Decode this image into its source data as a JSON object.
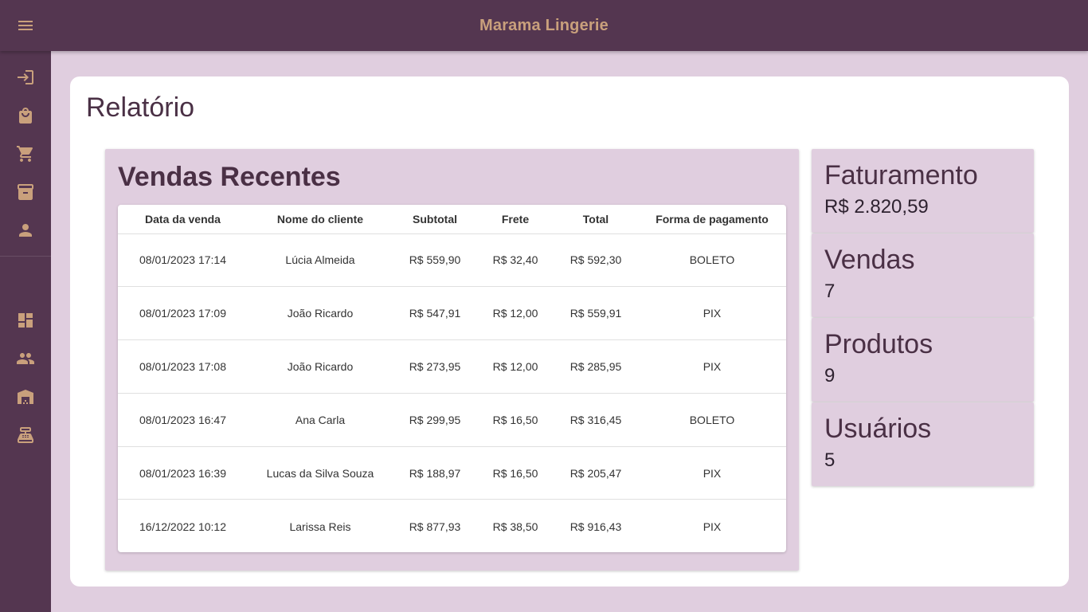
{
  "app": {
    "title": "Marama Lingerie"
  },
  "colors": {
    "primary": "#543650",
    "accent": "#c9a07c",
    "background": "#e0cedf"
  },
  "sidebar": {
    "top_items": [
      {
        "icon": "login-icon"
      },
      {
        "icon": "shopping-bag-icon"
      },
      {
        "icon": "cart-icon"
      },
      {
        "icon": "archive-icon"
      },
      {
        "icon": "person-icon"
      }
    ],
    "bottom_items": [
      {
        "icon": "dashboard-icon"
      },
      {
        "icon": "people-icon"
      },
      {
        "icon": "warehouse-icon"
      },
      {
        "icon": "cash-register-icon"
      }
    ]
  },
  "page": {
    "title": "Relatório"
  },
  "sales": {
    "title": "Vendas Recentes",
    "columns": [
      "Data da venda",
      "Nome do cliente",
      "Subtotal",
      "Frete",
      "Total",
      "Forma de pagamento"
    ],
    "rows": [
      [
        "08/01/2023 17:14",
        "Lúcia Almeida",
        "R$ 559,90",
        "R$ 32,40",
        "R$ 592,30",
        "BOLETO"
      ],
      [
        "08/01/2023 17:09",
        "João Ricardo",
        "R$ 547,91",
        "R$ 12,00",
        "R$ 559,91",
        "PIX"
      ],
      [
        "08/01/2023 17:08",
        "João Ricardo",
        "R$ 273,95",
        "R$ 12,00",
        "R$ 285,95",
        "PIX"
      ],
      [
        "08/01/2023 16:47",
        "Ana Carla",
        "R$ 299,95",
        "R$ 16,50",
        "R$ 316,45",
        "BOLETO"
      ],
      [
        "08/01/2023 16:39",
        "Lucas da Silva Souza",
        "R$ 188,97",
        "R$ 16,50",
        "R$ 205,47",
        "PIX"
      ],
      [
        "16/12/2022 10:12",
        "Larissa Reis",
        "R$ 877,93",
        "R$ 38,50",
        "R$ 916,43",
        "PIX"
      ]
    ]
  },
  "stats": [
    {
      "label": "Faturamento",
      "value": "R$ 2.820,59"
    },
    {
      "label": "Vendas",
      "value": "7"
    },
    {
      "label": "Produtos",
      "value": "9"
    },
    {
      "label": "Usuários",
      "value": "5"
    }
  ]
}
